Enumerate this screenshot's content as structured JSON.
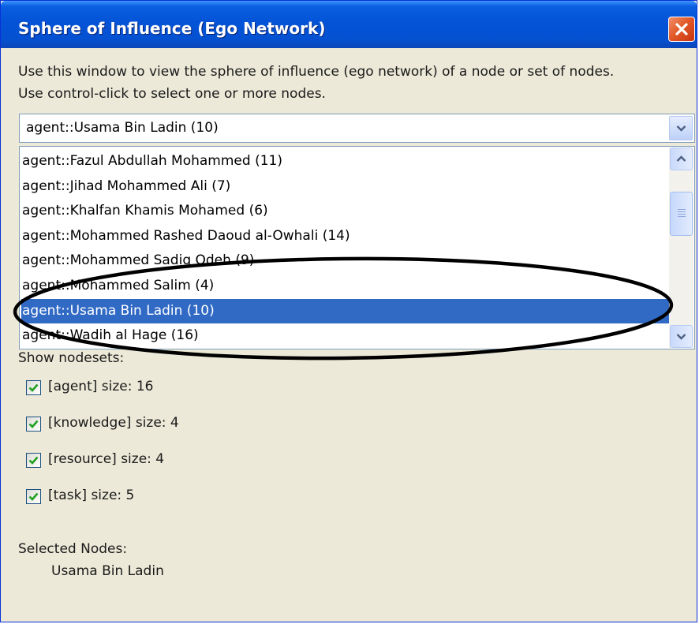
{
  "window": {
    "title": "Sphere of Influence (Ego Network)",
    "accent": "#0453d6",
    "close_color": "#e25a2a"
  },
  "description": {
    "line1": "Use this window to view the sphere of influence (ego network) of a node or set of nodes.",
    "line2": "Use control-click to select one or more nodes."
  },
  "node_select": {
    "value": "agent::Usama Bin Ladin (10)"
  },
  "node_list": {
    "items": [
      "agent::Fazul Abdullah Mohammed (11)",
      "agent::Jihad Mohammed Ali (7)",
      "agent::Khalfan Khamis Mohamed (6)",
      "agent::Mohammed Rashed Daoud al-Owhali (14)",
      "agent::Mohammed Sadiq Odeh (9)",
      "agent::Mohammed Salim (4)",
      "agent::Usama Bin Ladin (10)",
      "agent::Wadih al Hage (16)"
    ],
    "selected": "agent::Usama Bin Ladin (10)",
    "selection_color": "#316ac5"
  },
  "nodesets": {
    "label": "Show nodesets:",
    "items": [
      {
        "label": "[agent] size: 16",
        "checked": true
      },
      {
        "label": "[knowledge] size: 4",
        "checked": true
      },
      {
        "label": "[resource] size: 4",
        "checked": true
      },
      {
        "label": "[task] size: 5",
        "checked": true
      }
    ]
  },
  "selected_nodes": {
    "label": "Selected Nodes:",
    "value": "Usama Bin Ladin"
  },
  "icons": {
    "close": "close-icon",
    "dropdown": "chevron-down-icon",
    "scroll_up": "chevron-up-icon",
    "scroll_down": "chevron-down-icon",
    "check": "check-icon"
  }
}
